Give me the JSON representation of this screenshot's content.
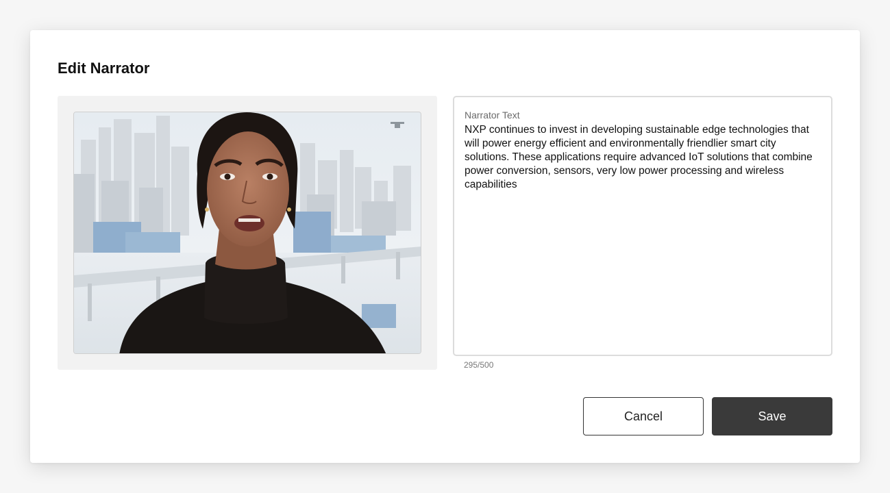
{
  "dialog": {
    "title": "Edit Narrator",
    "narrator_field": {
      "label": "Narrator Text",
      "value": "NXP continues to invest in developing sustainable edge technologies that will power energy efficient and environmentally friendlier smart city solutions. These applications require advanced IoT solutions that combine power conversion, sensors, very low power processing and wireless capabilities",
      "char_count": "295/500"
    },
    "buttons": {
      "cancel_label": "Cancel",
      "save_label": "Save"
    },
    "preview": {
      "image": "narrator-avatar-video-preview"
    }
  },
  "colors": {
    "save_bg": "#3a3a3a",
    "panel_bg": "#f2f2f2",
    "border": "#dcdcdc"
  }
}
